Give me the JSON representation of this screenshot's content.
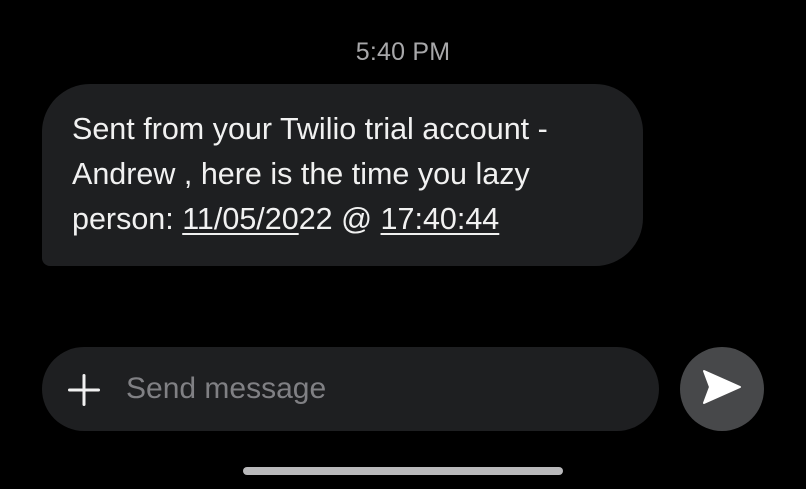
{
  "conversation": {
    "timestamp": "5:40 PM",
    "message": {
      "line1": "Sent from your Twilio trial account -",
      "line2": "Andrew , here is the time you lazy",
      "line3_prefix": "person: ",
      "date_link": "11/05/2022",
      "separator": " @ ",
      "time_link": "17:40:44",
      "date_link_underline_part": "11/05/20",
      "date_link_plain_part": "22"
    }
  },
  "composer": {
    "placeholder": "Send message",
    "value": "",
    "attach_icon": "plus-icon",
    "send_icon": "send-arrow-icon"
  },
  "colors": {
    "background": "#000000",
    "bubble": "#1e1f21",
    "send_button": "#47484a",
    "text": "#f1f1f1",
    "muted": "#a7a7a9"
  }
}
